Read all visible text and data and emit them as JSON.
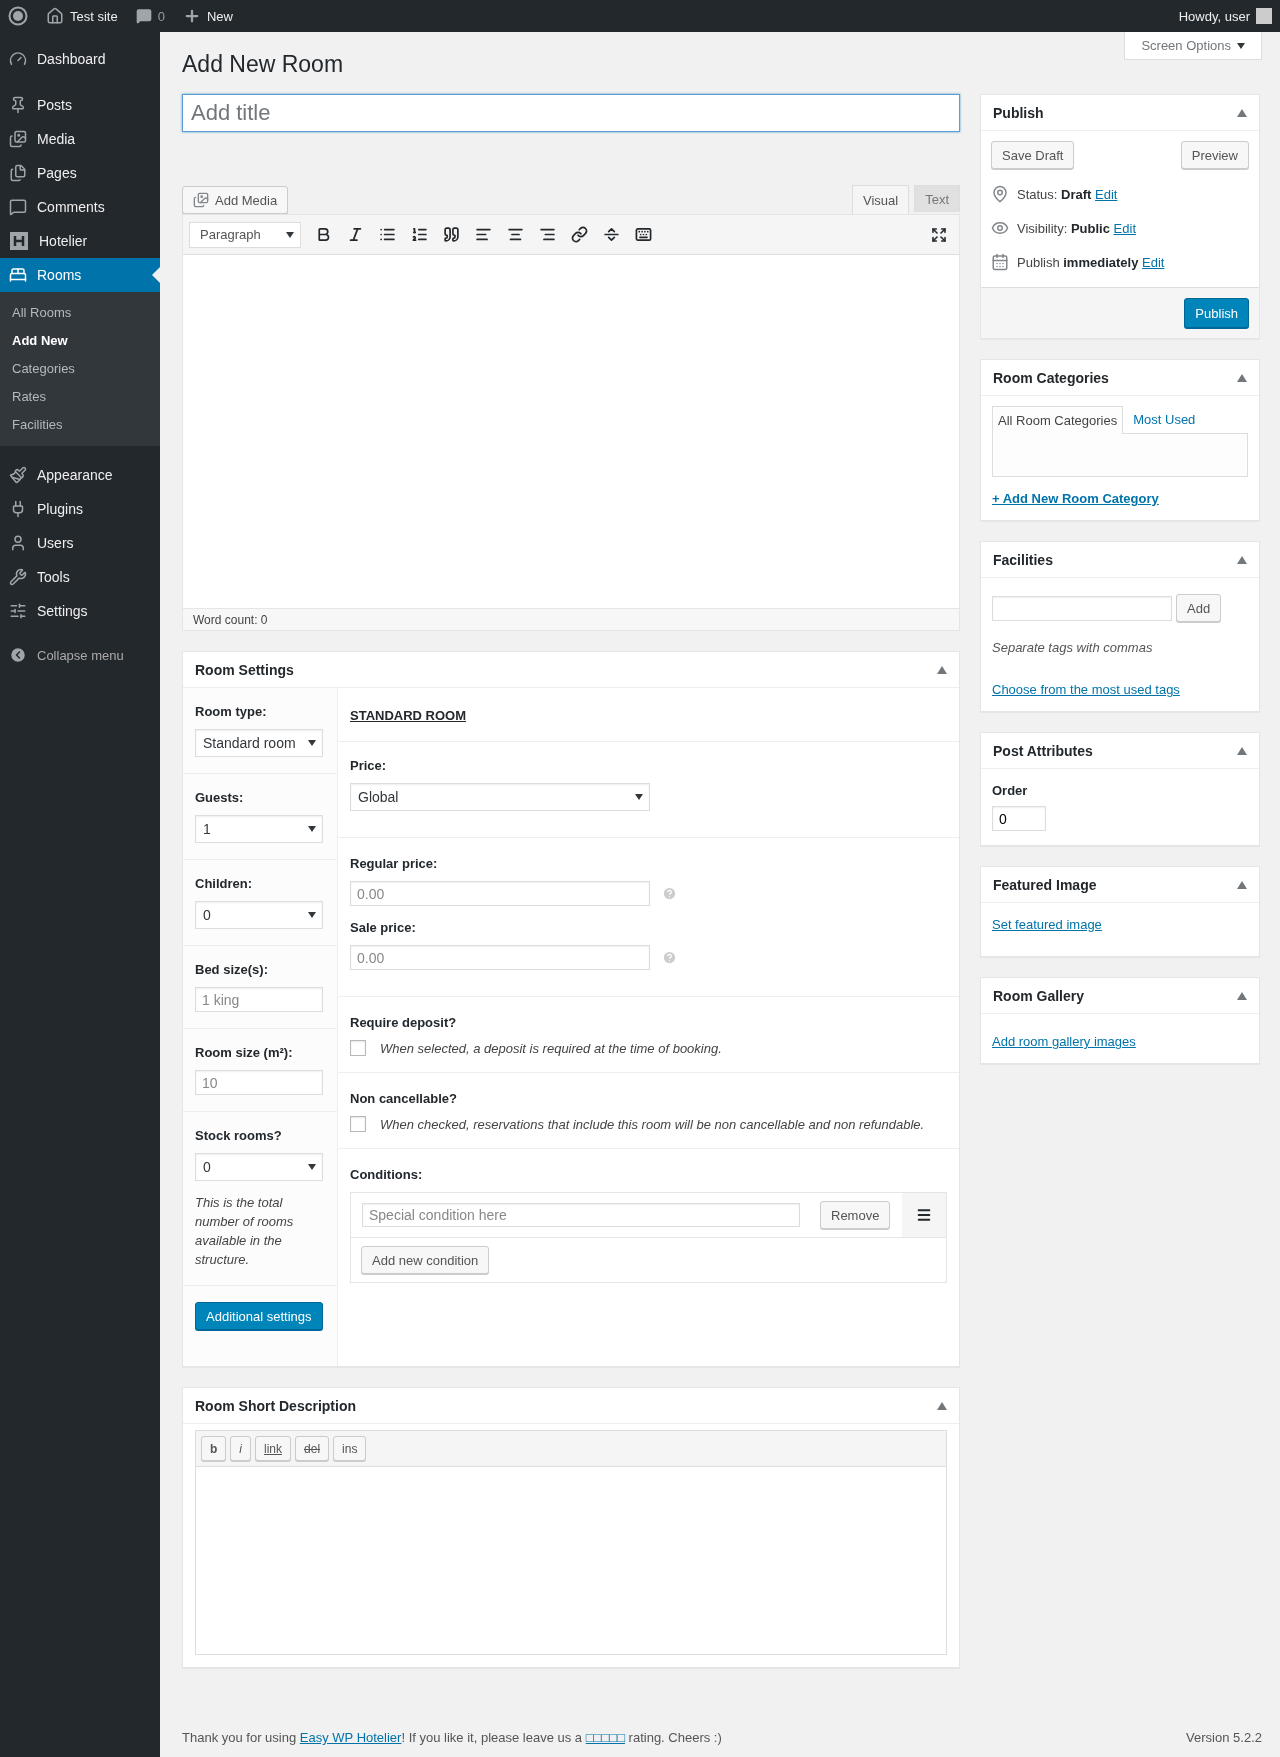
{
  "admin_bar": {
    "site": "Test site",
    "comments": "0",
    "new": "New",
    "greeting": "Howdy, user"
  },
  "sidebar": {
    "items": [
      {
        "label": "Dashboard",
        "selected": false
      },
      {
        "label": "Posts",
        "selected": false
      },
      {
        "label": "Media",
        "selected": false
      },
      {
        "label": "Pages",
        "selected": false
      },
      {
        "label": "Comments",
        "selected": false
      },
      {
        "label": "Hotelier",
        "selected": false
      },
      {
        "label": "Rooms",
        "selected": true,
        "children": [
          {
            "label": "All Rooms",
            "selected": false
          },
          {
            "label": "Add New",
            "selected": true
          },
          {
            "label": "Categories",
            "selected": false
          },
          {
            "label": "Rates",
            "selected": false
          },
          {
            "label": "Facilities",
            "selected": false
          }
        ]
      },
      {
        "label": "Appearance",
        "selected": false
      },
      {
        "label": "Plugins",
        "selected": false
      },
      {
        "label": "Users",
        "selected": false
      },
      {
        "label": "Tools",
        "selected": false
      },
      {
        "label": "Settings",
        "selected": false
      }
    ],
    "collapse": "Collapse menu"
  },
  "screen_options": "Screen Options",
  "page_title": "Add New Room",
  "title_field": {
    "placeholder": "Add title"
  },
  "editor": {
    "add_media": "Add Media",
    "tabs": [
      {
        "label": "Visual",
        "selected": true
      },
      {
        "label": "Text",
        "selected": false
      }
    ],
    "format": "Paragraph",
    "word_count": "Word count: 0"
  },
  "room_settings": {
    "title": "Room Settings",
    "fields": [
      {
        "kind": "select",
        "label": "Room type:",
        "value": "Standard room"
      },
      {
        "kind": "select",
        "label": "Guests:",
        "value": "1"
      },
      {
        "kind": "select",
        "label": "Children:",
        "value": "0"
      },
      {
        "kind": "input",
        "label": "Bed size(s):",
        "placeholder": "1 king"
      },
      {
        "kind": "input",
        "label": "Room size (m²):",
        "placeholder": "10"
      },
      {
        "kind": "select",
        "label": "Stock rooms?",
        "value": "0",
        "note": "This is the total number of rooms available in the structure."
      }
    ],
    "additional_settings": "Additional settings",
    "heading": "STANDARD ROOM",
    "price": {
      "label": "Price:",
      "value": "Global"
    },
    "regular_price": {
      "label": "Regular price:",
      "placeholder": "0.00"
    },
    "sale_price": {
      "label": "Sale price:",
      "placeholder": "0.00"
    },
    "options": [
      {
        "label": "Require deposit?",
        "checked": false,
        "description": "When selected, a deposit is required at the time of booking."
      },
      {
        "label": "Non cancellable?",
        "checked": false,
        "description": "When checked, reservations that include this room will be non cancellable and non refundable."
      }
    ],
    "conditions": {
      "label": "Conditions:",
      "placeholder": "Special condition here",
      "remove": "Remove",
      "add": "Add new condition"
    }
  },
  "short_description": {
    "title": "Room Short Description",
    "buttons": [
      {
        "kind": "bold",
        "label": "b"
      },
      {
        "kind": "italic",
        "label": "i"
      },
      {
        "kind": "link",
        "label": "link"
      },
      {
        "kind": "del",
        "label": "del"
      },
      {
        "kind": "ins",
        "label": "ins"
      }
    ]
  },
  "publish": {
    "title": "Publish",
    "save_draft": "Save Draft",
    "preview": "Preview",
    "rows": [
      {
        "text": "Status: **Draft**",
        "link": "Edit"
      },
      {
        "text": "Visibility: **Public**",
        "link": "Edit"
      },
      {
        "text": "Publish **immediately**",
        "link": "Edit"
      }
    ],
    "button": "Publish"
  },
  "room_categories": {
    "title": "Room Categories",
    "tabs": [
      {
        "label": "All Room Categories",
        "selected": true
      },
      {
        "label": "Most Used",
        "selected": false
      }
    ],
    "add_link": "+ Add New Room Category"
  },
  "facilities": {
    "title": "Facilities",
    "add": "Add",
    "hint": "Separate tags with commas",
    "link": "Choose from the most used tags"
  },
  "post_attributes": {
    "title": "Post Attributes",
    "label": "Order",
    "value": "0"
  },
  "featured_image": {
    "title": "Featured Image",
    "link": "Set featured image"
  },
  "room_gallery": {
    "title": "Room Gallery",
    "link": "Add room gallery images"
  },
  "footer": {
    "before": "Thank you for using ",
    "link": "Easy WP Hotelier",
    "middle": "! If you like it, please leave us a ",
    "rating_link": "□□□□□",
    "after": " rating. Cheers :)",
    "version": "Version 5.2.2"
  }
}
